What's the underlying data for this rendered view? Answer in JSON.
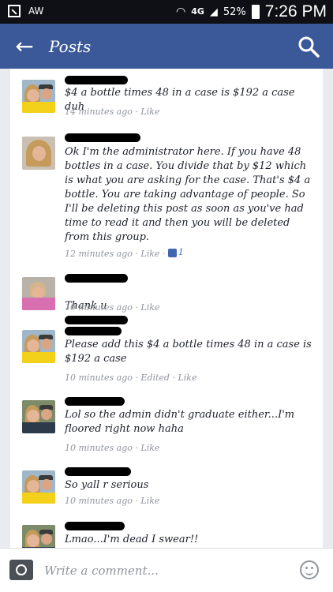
{
  "status_bar": {
    "carrier_text": "AW",
    "network": "4G",
    "battery": "52%",
    "time": "7:26 PM"
  },
  "header": {
    "title": "Posts"
  },
  "comments": [
    {
      "text": "$4 a bottle times 48 in a case is $192 a case duh",
      "time": "14 minutes ago",
      "like": "Like"
    },
    {
      "text": "Ok I'm the administrator here. If you have 48 bottles in a case. You divide that by $12 which is what you are asking for the case. That's $4 a bottle. You are taking advantage of people. So I'll be deleting this post as soon as you've had time to read it and then you will be deleted from this group.",
      "time": "12 minutes ago",
      "like": "Like",
      "like_count": "1"
    },
    {
      "text": "Thank u",
      "time": "10 minutes ago",
      "like": "Like"
    },
    {
      "text": "Please add this $4 a bottle times 48 in a case is $192 a case",
      "time": "10 minutes ago",
      "edited": "Edited",
      "like": "Like"
    },
    {
      "text": "Lol so the admin didn't graduate either...I'm floored right now haha",
      "time": "10 minutes ago",
      "like": "Like"
    },
    {
      "text": "So yall r serious",
      "time": "10 minutes ago",
      "like": "Like"
    },
    {
      "text": "Lmao...I'm dead I swear!!"
    }
  ],
  "composer": {
    "placeholder": "Write a comment..."
  },
  "icons": [
    "back-arrow-icon",
    "search-icon",
    "camera-icon",
    "emoji-icon",
    "thumbs-up-icon"
  ]
}
